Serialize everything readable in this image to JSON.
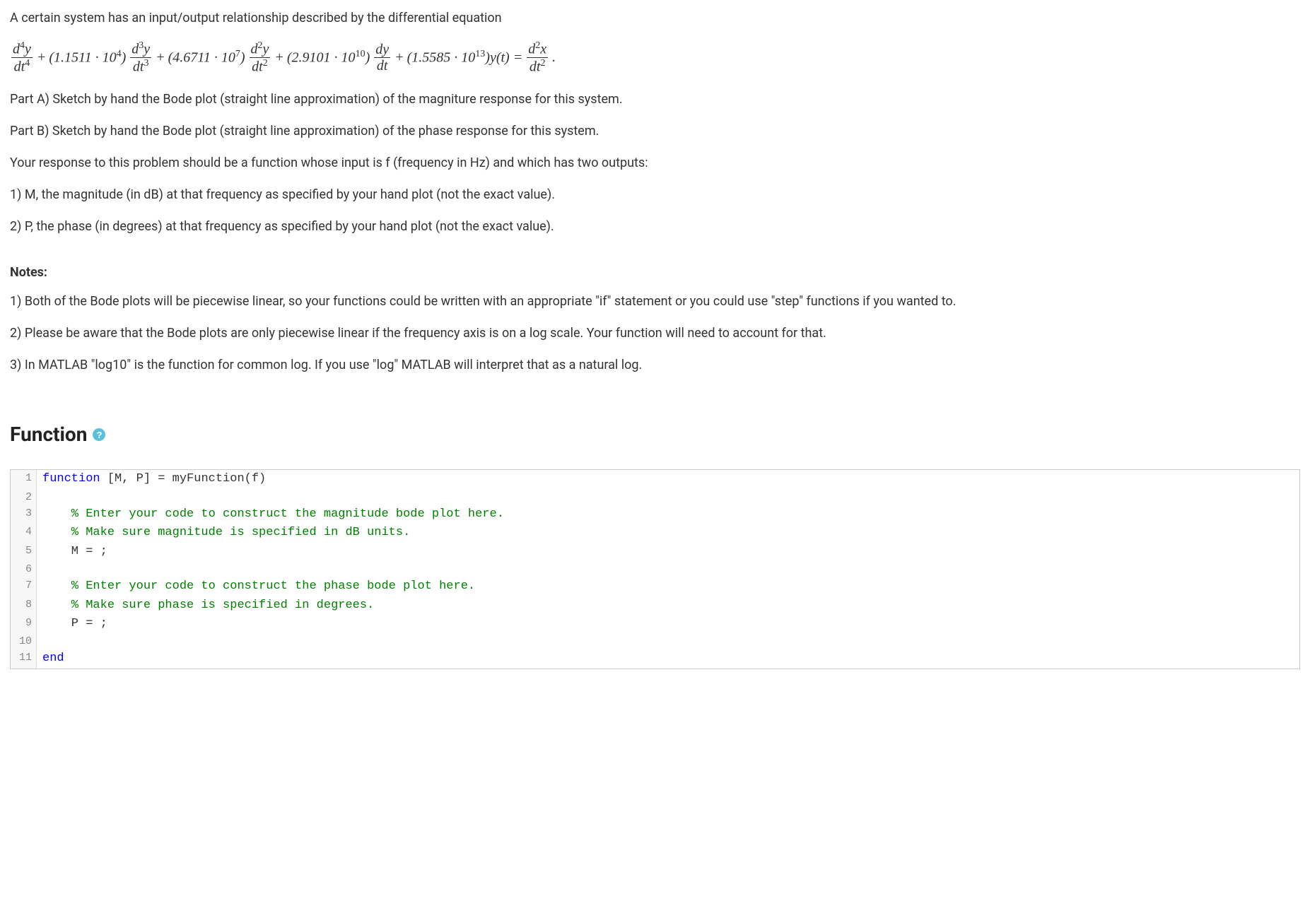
{
  "problem": {
    "intro": "A certain system has an input/output relationship described by the differential equation",
    "equation": {
      "c1": "(1.1511 · 10",
      "e1": "4",
      "c2": "(4.6711 · 10",
      "e2": "7",
      "c3": "(2.9101 · 10",
      "e3": "10",
      "c4": "(1.5585 · 10",
      "e4": "13",
      "yt": ")y(t) = ",
      "plus": " + ",
      "close_paren": ")",
      "period": "."
    },
    "partA": "Part A) Sketch by hand the Bode plot (straight line approximation) of the magniture response for this system.",
    "partB": "Part B) Sketch by hand the Bode plot (straight line approximation) of the phase response for this system.",
    "responseIntro": "Your response to this problem should be a function whose input is f (frequency in Hz) and which has two outputs:",
    "out1": "1) M, the magnitude (in dB) at that frequency as specified by your hand plot (not the exact value).",
    "out2": "2) P, the phase (in degrees) at that frequency as specified by your hand plot (not the exact value)."
  },
  "notes": {
    "heading": "Notes:",
    "n1": "1) Both of the Bode plots will be piecewise linear, so your functions could be written with an appropriate \"if\" statement or you could use \"step\" functions if you wanted to.",
    "n2": "2) Please be aware that the Bode plots are only piecewise linear if the frequency axis is on a log scale.  Your function will need to account for that.",
    "n3": "3) In MATLAB \"log10\" is the function for common log.  If you use \"log\" MATLAB will interpret that as a natural log."
  },
  "functionSection": {
    "heading": "Function",
    "helpGlyph": "?"
  },
  "code": {
    "l1_kw": "function",
    "l1_rest": " [M, P] = myFunction(f)",
    "l2": "",
    "l3": "    % Enter your code to construct the magnitude bode plot here.",
    "l4": "    % Make sure magnitude is specified in dB units.",
    "l5": "    M = ;",
    "l6": "",
    "l7": "    % Enter your code to construct the phase bode plot here.",
    "l8": "    % Make sure phase is specified in degrees.",
    "l9": "    P = ;",
    "l10": "",
    "l11_kw": "end",
    "lineNumbers": [
      "1",
      "2",
      "3",
      "4",
      "5",
      "6",
      "7",
      "8",
      "9",
      "10",
      "11"
    ]
  },
  "frac": {
    "d4y": "d",
    "d4y_sup": "4",
    "y": "y",
    "dt4": "dt",
    "dt4_sup": "4",
    "d3y_sup": "3",
    "dt3_sup": "3",
    "d2y_sup": "2",
    "dt2_sup": "2",
    "dy": "dy",
    "dt": "dt",
    "d2x_sup": "2",
    "x": "x"
  }
}
